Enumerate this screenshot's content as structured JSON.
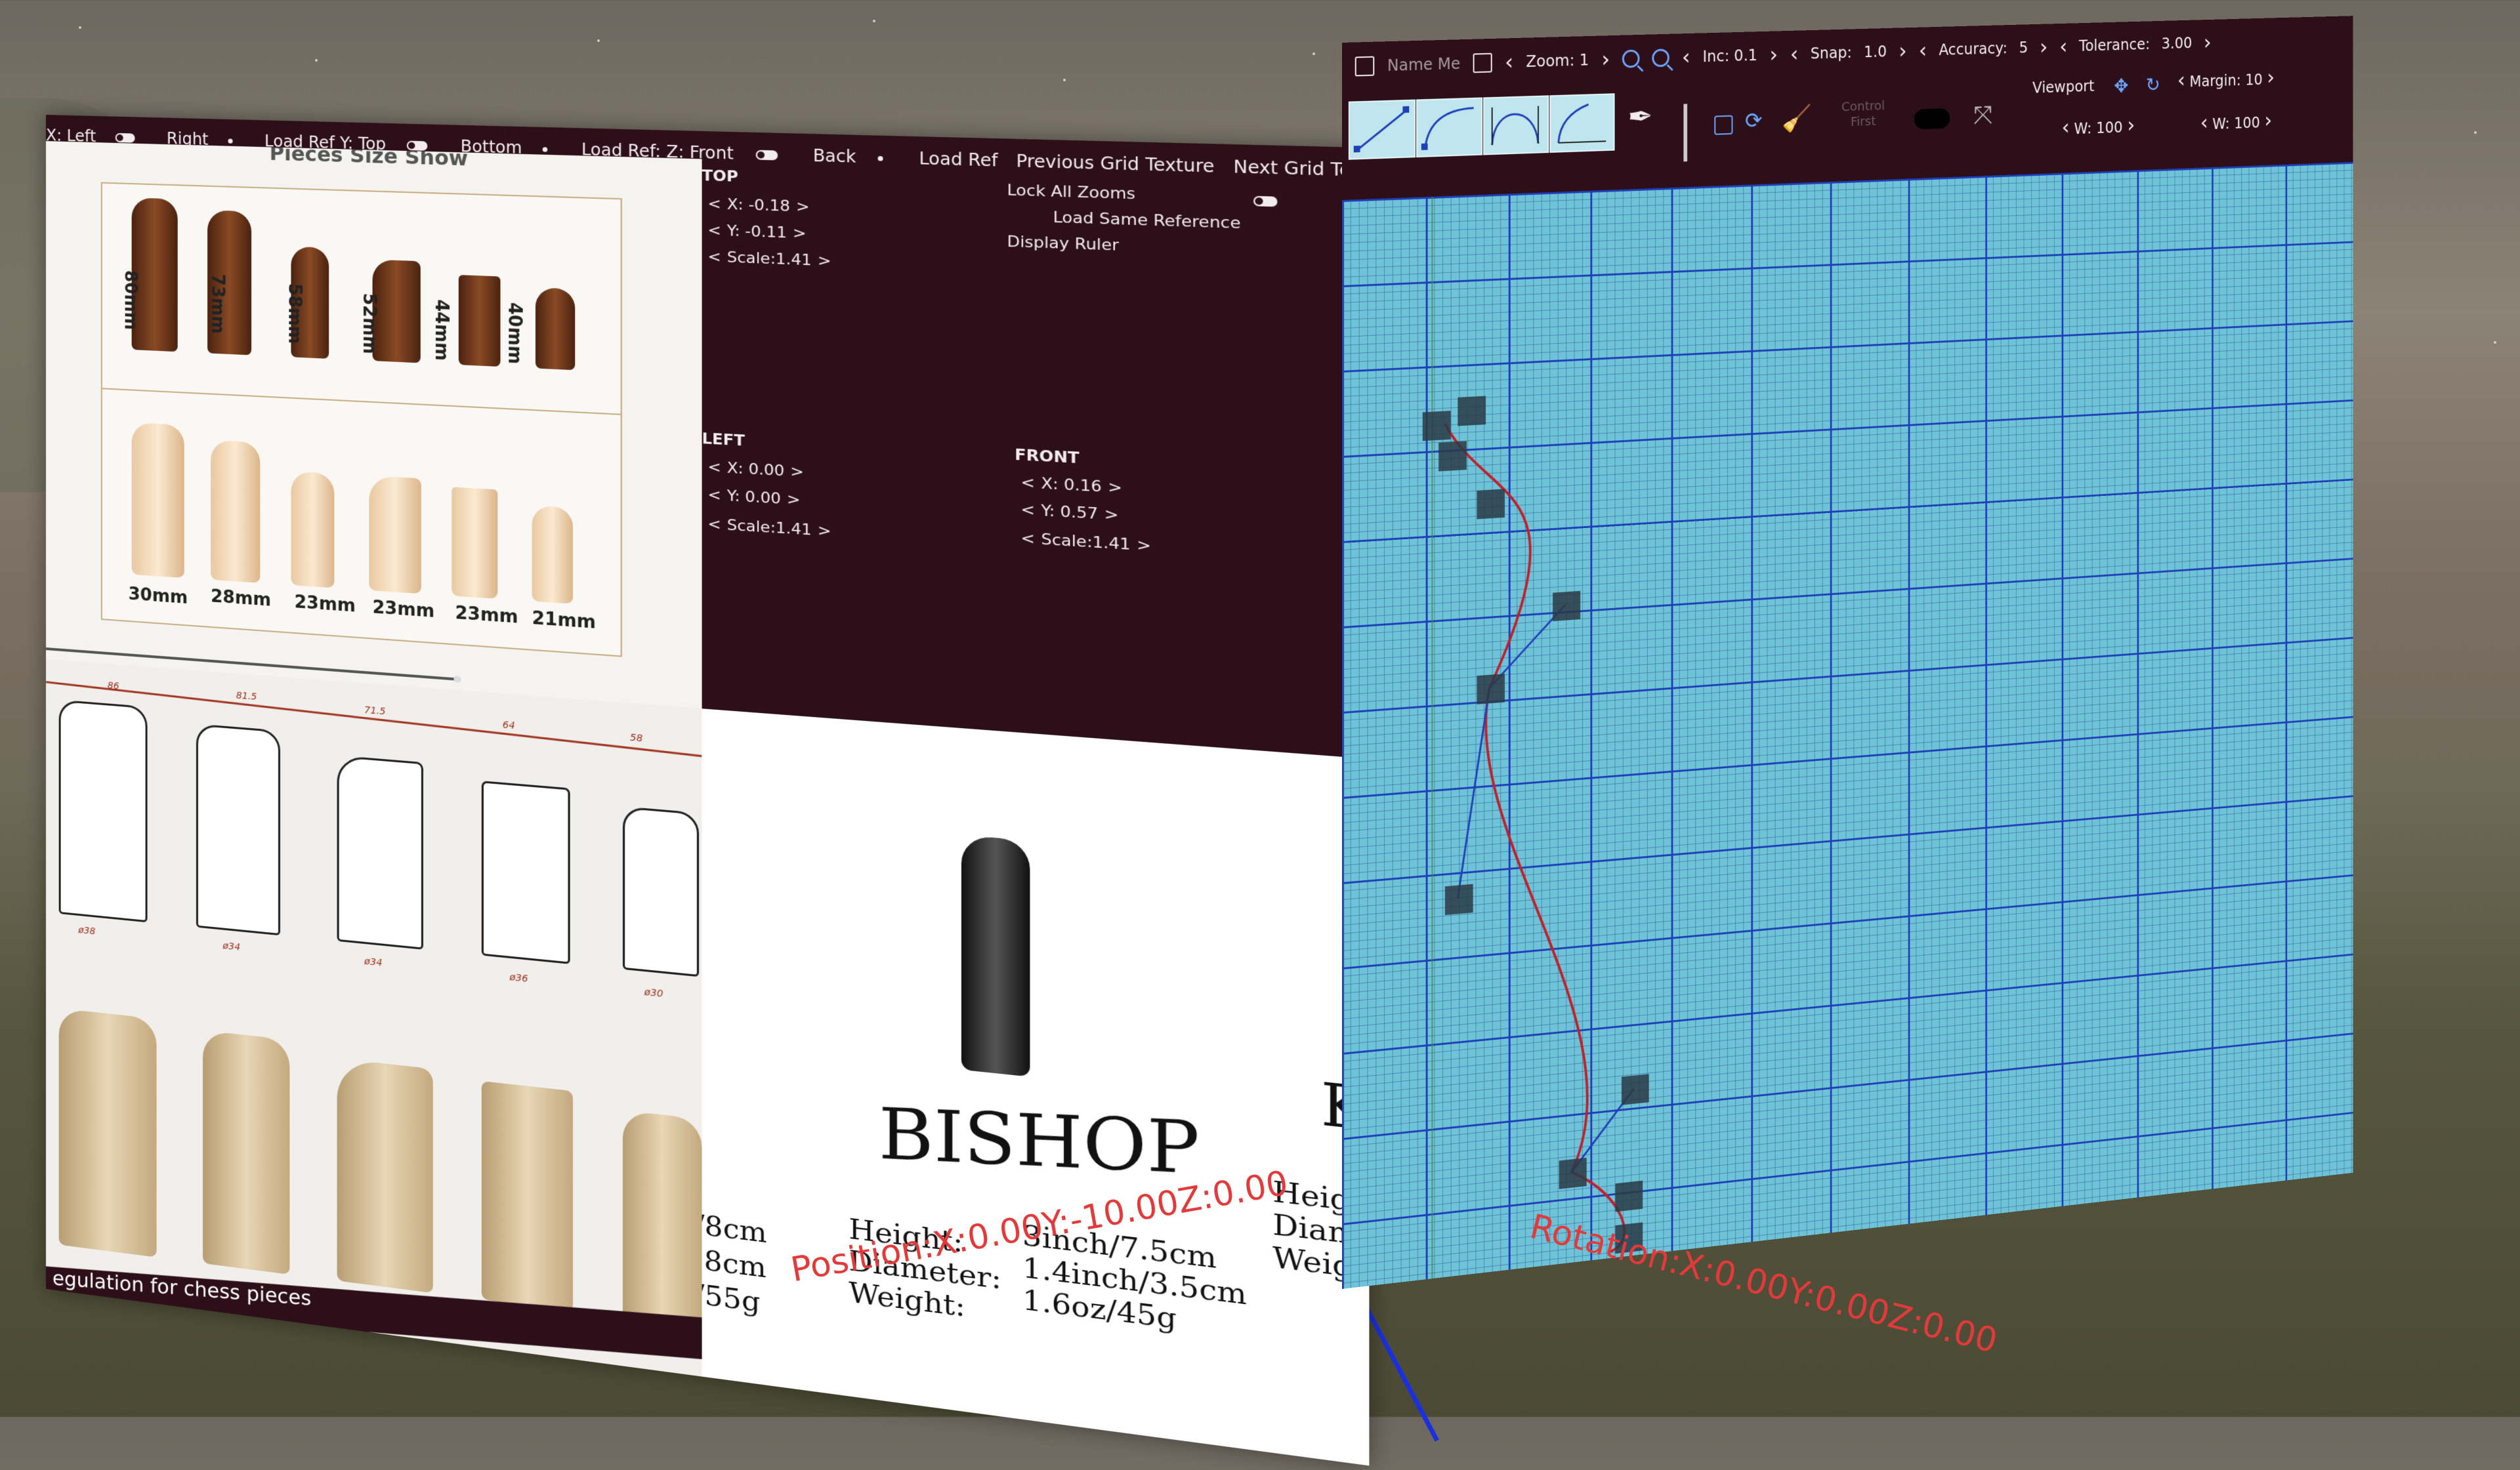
{
  "left_panel": {
    "topbar": {
      "x_label": "X: Left",
      "right_label": "Right",
      "load_ref_y": "Load Ref Y: Top",
      "bottom_label": "Bottom",
      "load_ref_z": "Load Ref: Z: Front",
      "back_label": "Back",
      "load_ref": "Load Ref",
      "prev_grid": "Previous Grid Texture",
      "next_grid": "Next Grid Texture"
    },
    "top_image": {
      "header": "Pieces Size Show",
      "dark_sizes": [
        "80mm",
        "73mm",
        "58mm",
        "52mm",
        "44mm",
        "40mm"
      ],
      "light_sizes": [
        "30mm",
        "28mm",
        "23mm",
        "23mm",
        "23mm",
        "21mm"
      ]
    },
    "top_view": {
      "title": "TOP",
      "x": "X: -0.18",
      "y": "Y: -0.11",
      "scale": "Scale:1.41"
    },
    "options": {
      "lock_all_zooms": "Lock All Zooms",
      "load_same_reference": "Load Same Reference",
      "display_ruler": "Display Ruler"
    },
    "left_view": {
      "title": "LEFT",
      "x": "X:  0.00",
      "y": "Y:  0.00",
      "scale": "Scale:1.41"
    },
    "front_view": {
      "title": "FRONT",
      "x": "X:  0.16",
      "y": "Y:  0.57",
      "scale": "Scale:1.41"
    },
    "blueprint": {
      "heights": [
        "86",
        "81.5",
        "71.5",
        "64",
        "58"
      ],
      "diameters": [
        "ø38",
        "ø34",
        "ø34",
        "ø36",
        "ø30"
      ],
      "caption": "egulation for chess pieces",
      "left_specs": [
        "/8cm",
        ".8cm",
        "/55g"
      ]
    },
    "bishop_card": {
      "title": "BISHOP",
      "height_label": "Height:",
      "height_value": "3inch/7.5cm",
      "diameter_label": "Diameter:",
      "diameter_value": "1.4inch/3.5cm",
      "weight_label": "Weight:",
      "weight_value": "1.6oz/45g",
      "next_initial": "K",
      "next_labels": [
        "Height:",
        "Diamete",
        "Weight:"
      ]
    },
    "position_readout": "Position:X:0.00Y:-10.00Z:0.00"
  },
  "right_panel": {
    "toolbar": {
      "name_placeholder": "Name Me",
      "zoom": "Zoom: 1",
      "inc": "Inc: 0.1",
      "snap_label": "Snap:",
      "snap_value": "1.0",
      "accuracy_label": "Accuracy:",
      "accuracy_value": "5",
      "tolerance_label": "Tolerance:",
      "tolerance_value": "3.00",
      "control_first": "Control First",
      "viewport": "Viewport",
      "margin": "Margin: 10",
      "w1_label": "W:",
      "w1_value": "100",
      "w2_label": "W:",
      "w2_value": "100"
    },
    "icons": [
      "new-file-icon",
      "save-icon",
      "zoom-in-icon",
      "zoom-out-icon",
      "pen-tool-icon",
      "checkbox-icon",
      "refresh-icon",
      "broom-icon",
      "toggle-icon",
      "vector-icon",
      "move-icon",
      "rotate-icon"
    ],
    "rotation_readout": "Rotation:X:0.00Y:0.00Z:0.00"
  },
  "colors": {
    "panel_bg": "#2d0f1a",
    "grid_bg": "#6ec3d7",
    "grid_major": "#1f3fb8",
    "curve": "#c0202a",
    "readout": "#e23a3a"
  }
}
